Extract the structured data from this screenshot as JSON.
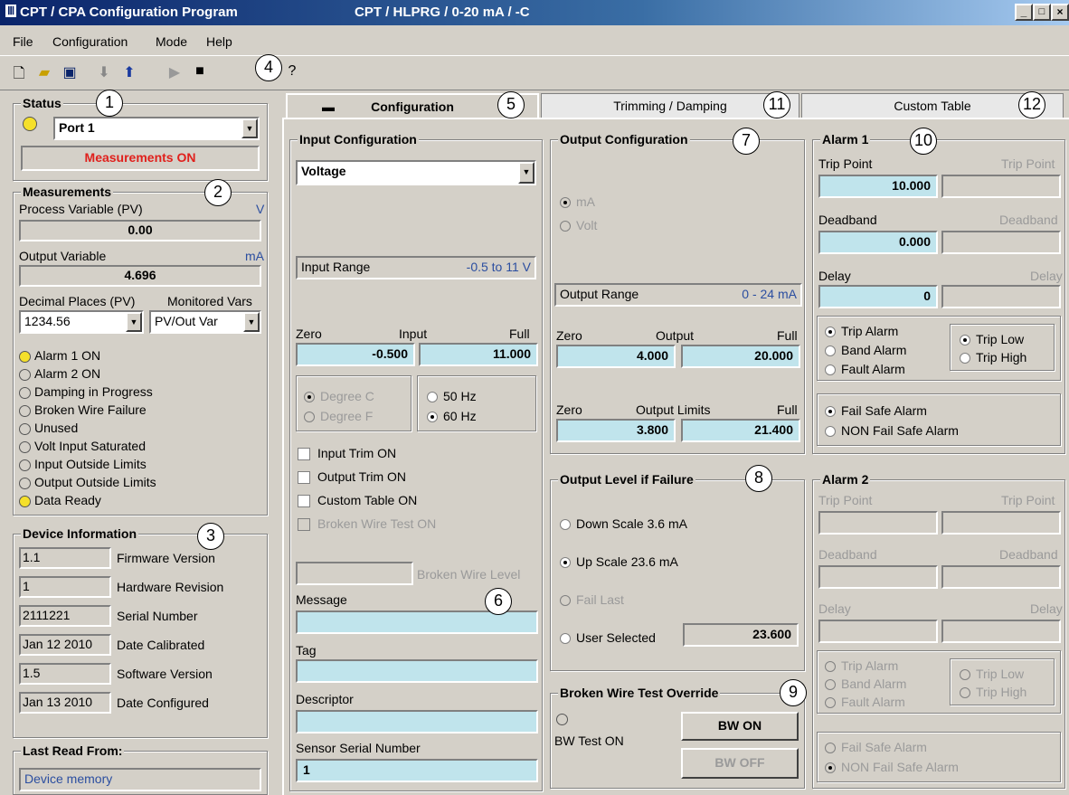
{
  "title": {
    "app": "CPT / CPA  Configuration Program",
    "device": "CPT / HLPRG / 0-20 mA / -C"
  },
  "menu": [
    "File",
    "Configuration",
    "Mode",
    "Help"
  ],
  "status": {
    "label": "Status",
    "port": "Port 1",
    "measurements_text": "Measurements ON"
  },
  "measurements": {
    "label": "Measurements",
    "pv_label": "Process Variable (PV)",
    "pv_unit": "V",
    "pv_value": "0.00",
    "ov_label": "Output Variable",
    "ov_unit": "mA",
    "ov_value": "4.696",
    "decimal_label": "Decimal Places (PV)",
    "decimal_value": "1234.56",
    "monitored_label": "Monitored Vars",
    "monitored_value": "PV/Out Var",
    "indicators": [
      {
        "label": "Alarm 1 ON",
        "on": true
      },
      {
        "label": "Alarm 2 ON",
        "on": false
      },
      {
        "label": "Damping in Progress",
        "on": false
      },
      {
        "label": "Broken Wire Failure",
        "on": false
      },
      {
        "label": "Unused",
        "on": false
      },
      {
        "label": "Volt Input Saturated",
        "on": false
      },
      {
        "label": "Input Outside Limits",
        "on": false
      },
      {
        "label": "Output Outside Limits",
        "on": false
      },
      {
        "label": "Data Ready",
        "on": true
      }
    ]
  },
  "device": {
    "label": "Device Information",
    "rows": [
      {
        "value": "1.1",
        "label": "Firmware Version"
      },
      {
        "value": "1",
        "label": "Hardware Revision"
      },
      {
        "value": "2111221",
        "label": "Serial Number"
      },
      {
        "value": "Jan 12 2010",
        "label": "Date Calibrated"
      },
      {
        "value": "1.5",
        "label": "Software Version"
      },
      {
        "value": "Jan 13 2010",
        "label": "Date Configured"
      }
    ]
  },
  "last_read": {
    "label": "Last Read From:",
    "value": "Device memory"
  },
  "tabs": [
    {
      "label": "Configuration"
    },
    {
      "label": "Trimming / Damping"
    },
    {
      "label": "Custom Table"
    }
  ],
  "input": {
    "label": "Input Configuration",
    "type": "Voltage",
    "range_label": "Input Range",
    "range_value": "-0.5 to 11 V",
    "zero": "Zero",
    "input": "Input",
    "full": "Full",
    "zero_value": "-0.500",
    "full_value": "11.000",
    "degc": "Degree C",
    "degf": "Degree F",
    "hz50": "50 Hz",
    "hz60": "60 Hz",
    "input_trim": "Input Trim ON",
    "output_trim": "Output Trim ON",
    "custom_table": "Custom Table ON",
    "bw_test": "Broken Wire Test ON",
    "bw_level": "Broken Wire Level",
    "message": "Message",
    "tag": "Tag",
    "descriptor": "Descriptor",
    "sensor_sn": "Sensor Serial Number",
    "sensor_sn_value": "1"
  },
  "output": {
    "label": "Output Configuration",
    "ma": "mA",
    "volt": "Volt",
    "range_label": "Output Range",
    "range_value": "0 - 24 mA",
    "zero": "Zero",
    "output": "Output",
    "full": "Full",
    "zero_value": "4.000",
    "full_value": "20.000",
    "limits": "Output Limits",
    "lim_zero": "3.800",
    "lim_full": "21.400"
  },
  "failure": {
    "label": "Output Level if Failure",
    "down": "Down Scale 3.6 mA",
    "up": "Up Scale 23.6 mA",
    "last": "Fail Last",
    "user": "User Selected",
    "user_value": "23.600"
  },
  "bw_override": {
    "label": "Broken Wire Test Override",
    "status": "BW Test ON",
    "on": "BW ON",
    "off": "BW OFF"
  },
  "alarm1": {
    "label": "Alarm 1",
    "trip": "Trip Point",
    "trip_value": "10.000",
    "deadband": "Deadband",
    "deadband_value": "0.000",
    "delay": "Delay",
    "delay_value": "0",
    "trip_alarm": "Trip Alarm",
    "band_alarm": "Band Alarm",
    "fault_alarm": "Fault Alarm",
    "trip_low": "Trip Low",
    "trip_high": "Trip High",
    "failsafe": "Fail Safe Alarm",
    "nonfailsafe": "NON Fail Safe Alarm"
  },
  "alarm2": {
    "label": "Alarm 2",
    "trip": "Trip Point",
    "deadband": "Deadband",
    "delay": "Delay",
    "trip_alarm": "Trip Alarm",
    "band_alarm": "Band Alarm",
    "fault_alarm": "Fault Alarm",
    "trip_low": "Trip Low",
    "trip_high": "Trip High",
    "failsafe": "Fail Safe Alarm",
    "nonfailsafe": "NON Fail Safe Alarm"
  },
  "callouts": [
    "1",
    "2",
    "3",
    "4",
    "5",
    "6",
    "7",
    "8",
    "9",
    "10",
    "11",
    "12"
  ]
}
